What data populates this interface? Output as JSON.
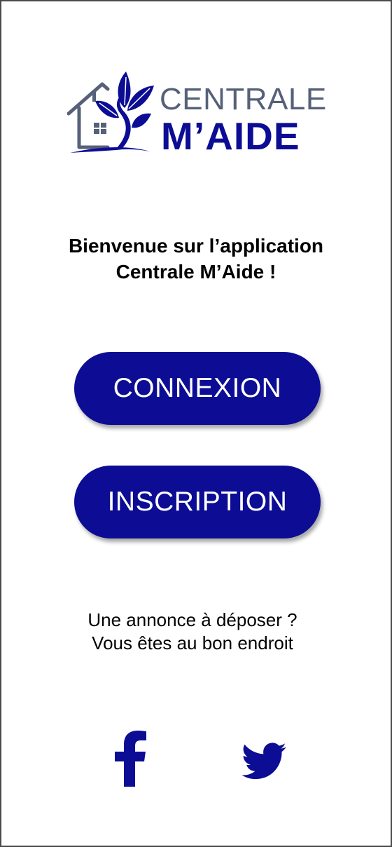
{
  "logo": {
    "line1": "CENTRALE",
    "line2": "M’AIDE",
    "icon": "house-tree-logo-icon"
  },
  "welcome": {
    "line1": "Bienvenue sur l’application",
    "line2": "Centrale M’Aide !"
  },
  "buttons": {
    "login_label": "CONNEXION",
    "signup_label": "INSCRIPTION"
  },
  "tagline": {
    "line1": "Une annonce à déposer ?",
    "line2": "Vous êtes au bon endroit"
  },
  "social": {
    "facebook_icon": "facebook-icon",
    "twitter_icon": "twitter-icon"
  },
  "colors": {
    "brand_blue": "#0c0d94",
    "logo_gray": "#566079",
    "text": "#000000",
    "background": "#ffffff"
  }
}
